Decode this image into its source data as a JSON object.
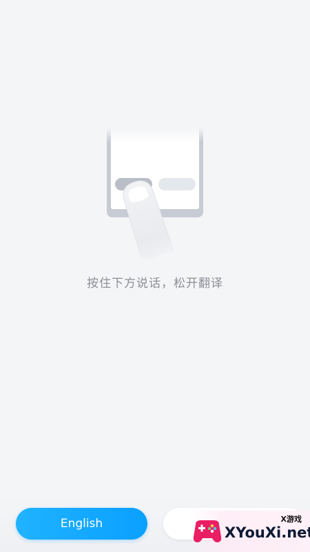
{
  "hint": {
    "text": "按住下方说话，松开翻译"
  },
  "buttons": {
    "english_label": "English",
    "chinese_label": ""
  },
  "watermark": {
    "small_text": "X游戏",
    "site_text": "XYouXi.net"
  },
  "colors": {
    "background": "#f4f5f7",
    "accent": "#0aa0ff",
    "hint_text": "#8b8e94"
  },
  "icons": {
    "illustration": "press-to-talk-finger-icon",
    "watermark_logo": "gamepad-logo-icon"
  }
}
